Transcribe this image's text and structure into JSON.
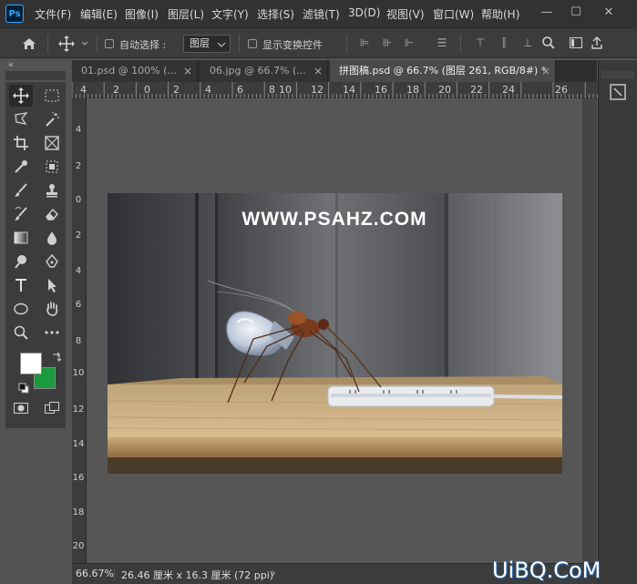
{
  "app": {
    "logo": "Ps"
  },
  "menu": [
    "文件(F)",
    "编辑(E)",
    "图像(I)",
    "图层(L)",
    "文字(Y)",
    "选择(S)",
    "滤镜(T)",
    "3D(D)",
    "视图(V)",
    "窗口(W)",
    "帮助(H)"
  ],
  "window_controls": {
    "minimize": "—",
    "maximize": "☐",
    "close": "✕"
  },
  "options": {
    "auto_select_label": "自动选择 :",
    "layer_select_value": "图层",
    "show_transform_label": "显示变换控件"
  },
  "tabs": [
    {
      "label": "01.psd @ 100% (..."
    },
    {
      "label": "06.jpg @ 66.7% (..."
    },
    {
      "label": "拼图稿.psd @ 66.7% (图层 261, RGB/8#) *"
    }
  ],
  "ruler_h": [
    "4",
    "2",
    "0",
    "2",
    "4",
    "6",
    "8",
    "10",
    "12",
    "14",
    "16",
    "18",
    "20",
    "22",
    "24",
    "26"
  ],
  "ruler_v": [
    "4",
    "2",
    "0",
    "2",
    "4",
    "6",
    "8",
    "10",
    "12",
    "14",
    "16",
    "18",
    "20"
  ],
  "document": {
    "watermark": "WWW.PSAHZ.COM"
  },
  "status": {
    "zoom": "66.67%",
    "doc_info": "26.46 厘米 x 16.3 厘米 (72 ppi)"
  },
  "colors": {
    "foreground": "#ffffff",
    "background": "#1a9a3c",
    "accent": "#31a8ff"
  },
  "site_logo": "UiBQ.CoM"
}
